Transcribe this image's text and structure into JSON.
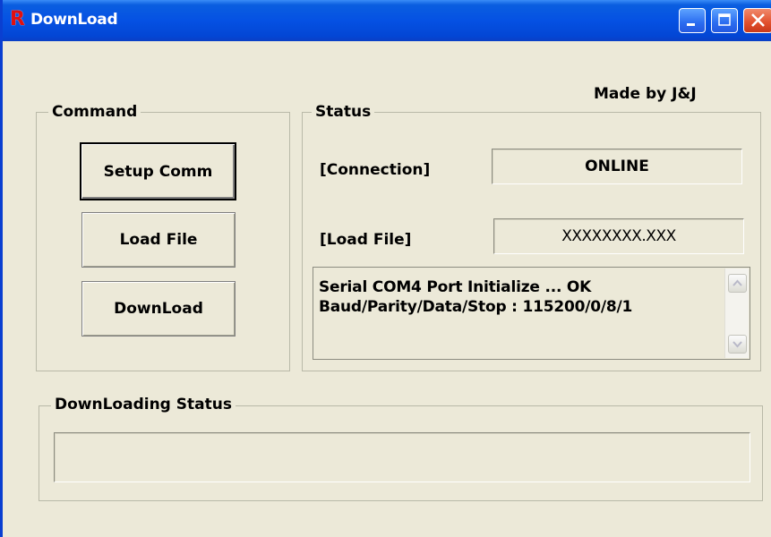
{
  "window": {
    "title": "DownLoad",
    "app_icon_glyph": "R",
    "app_icon_color": "#e01010",
    "titlebar_color": "#0551e3"
  },
  "made_by": "Made by J&J",
  "command": {
    "group_label": "Command",
    "buttons": {
      "setup_comm": "Setup Comm",
      "load_file": "Load File",
      "download": "DownLoad"
    }
  },
  "status": {
    "group_label": "Status",
    "connection_label": "[Connection]",
    "connection_value": "ONLINE",
    "load_file_label": "[Load File]",
    "load_file_value": "XXXXXXXX.XXX",
    "log_lines": [
      "Serial COM4 Port Initialize ... OK",
      "Baud/Parity/Data/Stop : 115200/0/8/1"
    ]
  },
  "downloading": {
    "group_label": "DownLoading Status",
    "progress_value": ""
  }
}
